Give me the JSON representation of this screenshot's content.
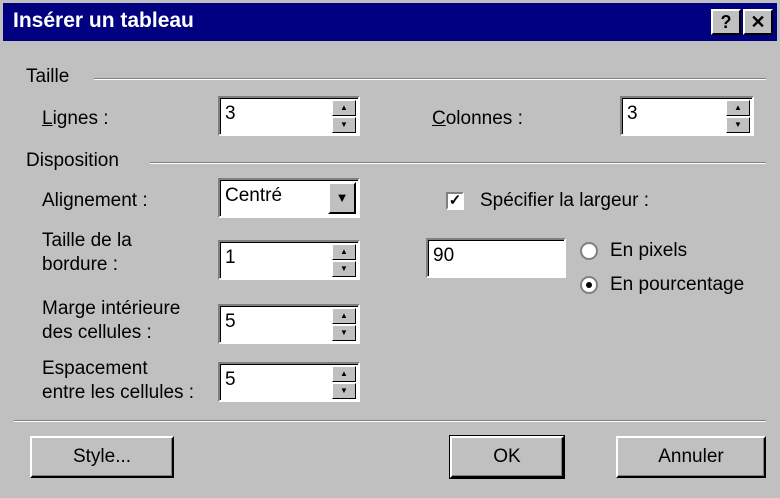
{
  "window": {
    "title": "Insérer un tableau",
    "help": "?",
    "close": "✕"
  },
  "taille": {
    "group": "Taille",
    "lignes_label": "Lignes :",
    "lignes_value": "3",
    "colonnes_label": "Colonnes :",
    "colonnes_value": "3"
  },
  "disposition": {
    "group": "Disposition",
    "alignement_label": "Alignement :",
    "alignement_value": "Centré",
    "bordure_label_1": "Taille de la",
    "bordure_label_2": "bordure :",
    "bordure_value": "1",
    "marge_label_1": "Marge intérieure",
    "marge_label_2": "des cellules :",
    "marge_value": "5",
    "espacement_label_1": "Espacement",
    "espacement_label_2": "entre les cellules :",
    "espacement_value": "5",
    "largeur_label": "Spécifier la largeur :",
    "largeur_checked": true,
    "largeur_value": "90",
    "pixels_label": "En pixels",
    "pourcentage_label": "En pourcentage",
    "selected_unit": "pourcentage"
  },
  "buttons": {
    "style": "Style...",
    "ok": "OK",
    "annuler": "Annuler"
  }
}
